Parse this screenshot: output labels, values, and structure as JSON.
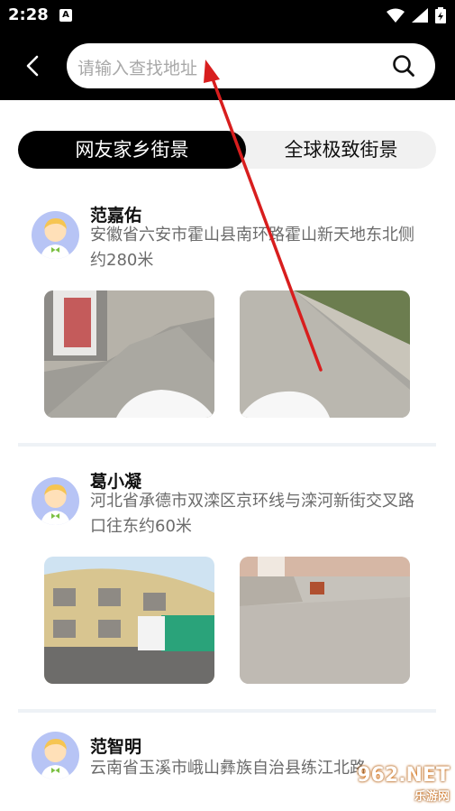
{
  "status_bar": {
    "time": "2:28",
    "app_icon_letter": "A"
  },
  "search": {
    "placeholder": "请输入查找地址"
  },
  "tabs": [
    {
      "label": "网友家乡街景",
      "active": true
    },
    {
      "label": "全球极致街景",
      "active": false
    }
  ],
  "cards": [
    {
      "name": "范嘉佑",
      "address": "安徽省六安市霍山县南环路霍山新天地东北侧约280米"
    },
    {
      "name": "葛小凝",
      "address": "河北省承德市双滦区京环线与滦河新街交叉路口往东约60米"
    },
    {
      "name": "范智明",
      "address": "云南省玉溪市峨山彝族自治县练江北路"
    }
  ],
  "watermark": {
    "text": "962.NET",
    "sub": "乐游网"
  },
  "colors": {
    "bar": "#000000",
    "tab_bg": "#f1f1f1",
    "avatar_bg": "#b7c4f5",
    "arrow": "#d81e1e"
  }
}
